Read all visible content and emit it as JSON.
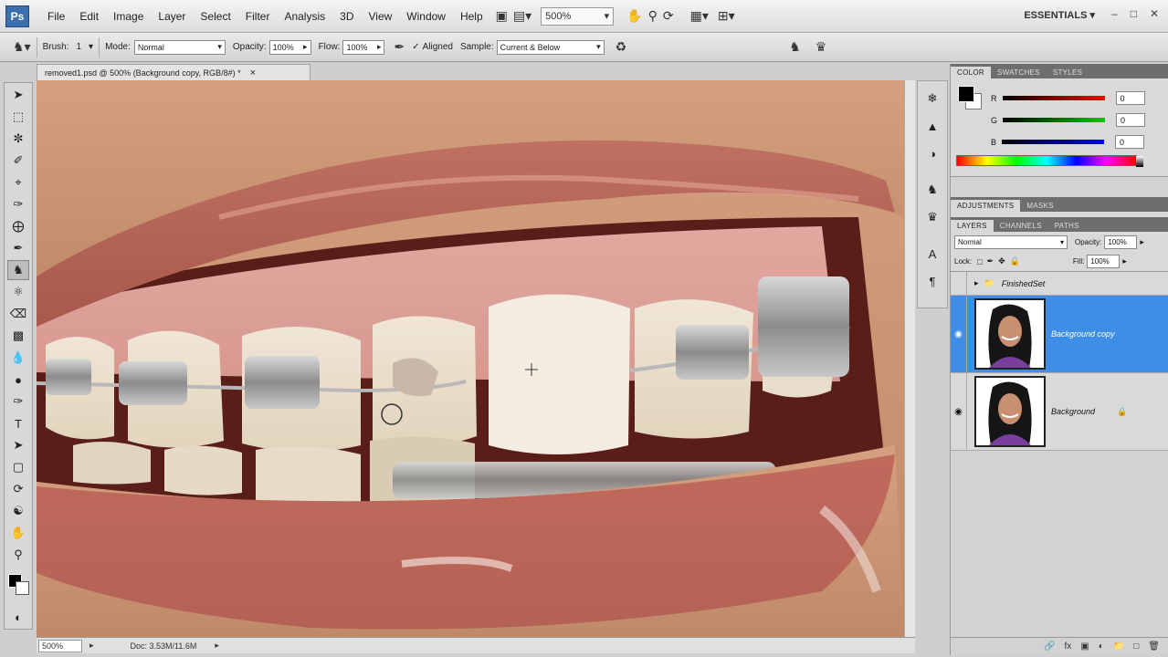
{
  "app": {
    "logo": "Ps",
    "menus": [
      "File",
      "Edit",
      "Image",
      "Layer",
      "Select",
      "Filter",
      "Analysis",
      "3D",
      "View",
      "Window",
      "Help"
    ],
    "zoom": "500%",
    "workspace": "ESSENTIALS ▾",
    "window_controls": [
      "–",
      "□",
      "✕"
    ]
  },
  "options": {
    "brush_label": "Brush:",
    "brush_size": "1",
    "mode_label": "Mode:",
    "mode_value": "Normal",
    "opacity_label": "Opacity:",
    "opacity_value": "100%",
    "flow_label": "Flow:",
    "flow_value": "100%",
    "aligned_label": "Aligned",
    "sample_label": "Sample:",
    "sample_value": "Current & Below"
  },
  "document": {
    "tab_title": "removed1.psd @ 500% (Background copy, RGB/8#) *",
    "close": "×",
    "status_zoom": "500%",
    "status_doc": "Doc: 3.53M/11.6M"
  },
  "color_panel": {
    "tabs": [
      "COLOR",
      "SWATCHES",
      "STYLES"
    ],
    "channels": [
      {
        "label": "R",
        "value": "0",
        "color": "#e02020"
      },
      {
        "label": "G",
        "value": "0",
        "color": "#20b020"
      },
      {
        "label": "B",
        "value": "0",
        "color": "#2030d0"
      }
    ]
  },
  "adjust_panel": {
    "tabs": [
      "ADJUSTMENTS",
      "MASKS"
    ]
  },
  "layers_panel": {
    "tabs": [
      "LAYERS",
      "CHANNELS",
      "PATHS"
    ],
    "blend_mode": "Normal",
    "opacity_label": "Opacity:",
    "opacity_value": "100%",
    "lock_label": "Lock:",
    "fill_label": "Fill:",
    "fill_value": "100%",
    "group_name": "FinishedSet",
    "layers": [
      {
        "name": "Background copy",
        "selected": true
      },
      {
        "name": "Background",
        "selected": false
      }
    ]
  },
  "tools": [
    "move-tool",
    "marquee-tool",
    "lasso-tool",
    "quick-select-tool",
    "crop-tool",
    "eyedropper-tool",
    "spot-heal-tool",
    "brush-tool",
    "clone-stamp-tool",
    "history-brush-tool",
    "eraser-tool",
    "gradient-tool",
    "blur-tool",
    "dodge-tool",
    "pen-tool",
    "type-tool",
    "path-select-tool",
    "shape-tool",
    "3d-rotate-tool",
    "3d-orbit-tool",
    "hand-tool",
    "zoom-tool"
  ]
}
